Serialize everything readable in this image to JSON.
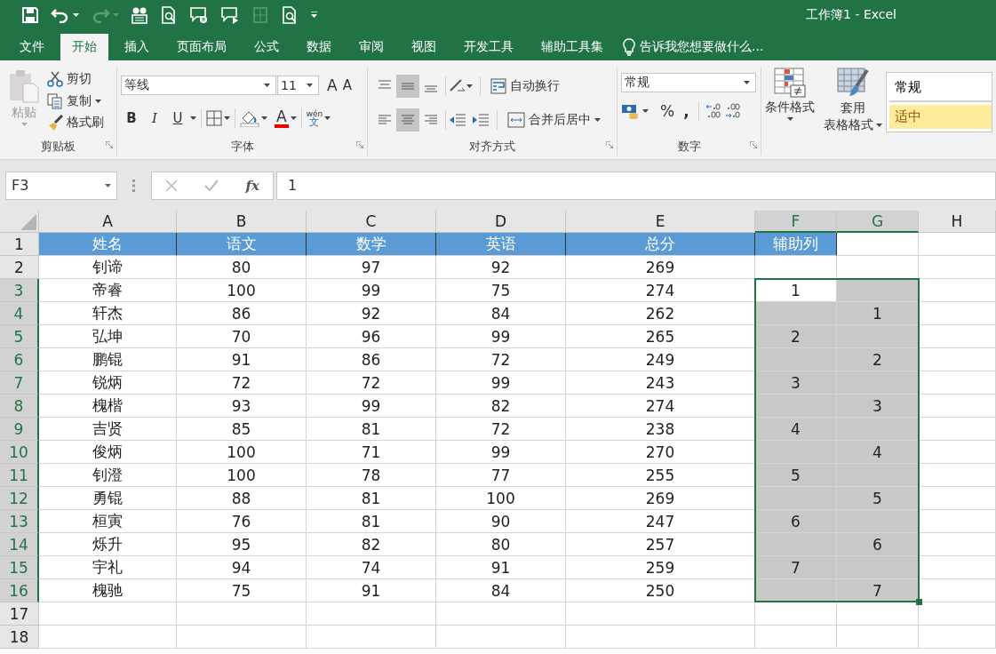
{
  "window": {
    "title": "工作簿1 - Excel"
  },
  "ribbon_tabs": [
    {
      "label": "文件",
      "selected": false
    },
    {
      "label": "开始",
      "selected": true
    },
    {
      "label": "插入",
      "selected": false
    },
    {
      "label": "页面布局",
      "selected": false
    },
    {
      "label": "公式",
      "selected": false
    },
    {
      "label": "数据",
      "selected": false
    },
    {
      "label": "审阅",
      "selected": false
    },
    {
      "label": "视图",
      "selected": false
    },
    {
      "label": "开发工具",
      "selected": false
    },
    {
      "label": "辅助工具集",
      "selected": false
    }
  ],
  "tell_me": "告诉我您想要做什么...",
  "clipboard": {
    "paste": "粘贴",
    "cut": "剪切",
    "copy": "复制",
    "format_painter": "格式刷",
    "label": "剪贴板"
  },
  "font": {
    "name": "等线",
    "size": "11",
    "grow": "A",
    "shrink": "A",
    "bold": "B",
    "italic": "I",
    "underline": "U",
    "color_button": "A",
    "phonetic_top": "wén",
    "phonetic_bottom": "文",
    "label": "字体"
  },
  "alignment": {
    "vertical": [
      {
        "selected": false
      },
      {
        "selected": true
      },
      {
        "selected": false
      }
    ],
    "horizontal": [
      {
        "selected": false
      },
      {
        "selected": true
      },
      {
        "selected": false
      }
    ],
    "wrap_text": "自动换行",
    "merge": "合并后居中",
    "label": "对齐方式"
  },
  "number": {
    "format": "常规",
    "percent": "%",
    "comma": ",",
    "label": "数字"
  },
  "styles": {
    "conditional_format": "条件格式",
    "table_format_line1": "套用",
    "table_format_line2": "表格格式",
    "cell_styles": [
      {
        "label": "常规",
        "kind": "normal"
      },
      {
        "label": "适中",
        "kind": "neutral"
      }
    ]
  },
  "formula_bar": {
    "name_box": "F3",
    "function_label": "fx",
    "value": "1"
  },
  "sheet": {
    "columns": [
      {
        "label": "A",
        "selected": false
      },
      {
        "label": "B",
        "selected": false
      },
      {
        "label": "C",
        "selected": false
      },
      {
        "label": "D",
        "selected": false
      },
      {
        "label": "E",
        "selected": false
      },
      {
        "label": "F",
        "selected": true
      },
      {
        "label": "G",
        "selected": true
      },
      {
        "label": "H",
        "selected": false
      }
    ],
    "rows": [
      {
        "number": "1",
        "selected": false,
        "kind": "header",
        "cells": [
          "姓名",
          "语文",
          "数学",
          "英语",
          "总分"
        ],
        "aux": [
          {
            "text": "辅助列",
            "header": true,
            "selected": false
          },
          {
            "header": false,
            "selected": false
          }
        ]
      },
      {
        "number": "2",
        "selected": false,
        "kind": "data",
        "cells": [
          "钊谛",
          "80",
          "97",
          "92",
          "269"
        ],
        "aux": [
          {
            "header": false,
            "selected": false
          },
          {
            "header": false,
            "selected": false
          }
        ]
      },
      {
        "number": "3",
        "selected": true,
        "kind": "data",
        "cells": [
          "帝睿",
          "100",
          "99",
          "75",
          "274"
        ],
        "aux": [
          {
            "text": "1",
            "header": false,
            "selected": true
          },
          {
            "header": false,
            "selected": true
          }
        ]
      },
      {
        "number": "4",
        "selected": true,
        "kind": "data",
        "cells": [
          "轩杰",
          "86",
          "92",
          "84",
          "262"
        ],
        "aux": [
          {
            "header": false,
            "selected": true
          },
          {
            "text": "1",
            "header": false,
            "selected": true
          }
        ]
      },
      {
        "number": "5",
        "selected": true,
        "kind": "data",
        "cells": [
          "弘坤",
          "70",
          "96",
          "99",
          "265"
        ],
        "aux": [
          {
            "text": "2",
            "header": false,
            "selected": true
          },
          {
            "header": false,
            "selected": true
          }
        ]
      },
      {
        "number": "6",
        "selected": true,
        "kind": "data",
        "cells": [
          "鹏锟",
          "91",
          "86",
          "72",
          "249"
        ],
        "aux": [
          {
            "header": false,
            "selected": true
          },
          {
            "text": "2",
            "header": false,
            "selected": true
          }
        ]
      },
      {
        "number": "7",
        "selected": true,
        "kind": "data",
        "cells": [
          "锐炳",
          "72",
          "72",
          "99",
          "243"
        ],
        "aux": [
          {
            "text": "3",
            "header": false,
            "selected": true
          },
          {
            "header": false,
            "selected": true
          }
        ]
      },
      {
        "number": "8",
        "selected": true,
        "kind": "data",
        "cells": [
          "槐楷",
          "93",
          "99",
          "82",
          "274"
        ],
        "aux": [
          {
            "header": false,
            "selected": true
          },
          {
            "text": "3",
            "header": false,
            "selected": true
          }
        ]
      },
      {
        "number": "9",
        "selected": true,
        "kind": "data",
        "cells": [
          "吉贤",
          "85",
          "81",
          "72",
          "238"
        ],
        "aux": [
          {
            "text": "4",
            "header": false,
            "selected": true
          },
          {
            "header": false,
            "selected": true
          }
        ]
      },
      {
        "number": "10",
        "selected": true,
        "kind": "data",
        "cells": [
          "俊炳",
          "100",
          "71",
          "99",
          "270"
        ],
        "aux": [
          {
            "header": false,
            "selected": true
          },
          {
            "text": "4",
            "header": false,
            "selected": true
          }
        ]
      },
      {
        "number": "11",
        "selected": true,
        "kind": "data",
        "cells": [
          "钊澄",
          "100",
          "78",
          "77",
          "255"
        ],
        "aux": [
          {
            "text": "5",
            "header": false,
            "selected": true
          },
          {
            "header": false,
            "selected": true
          }
        ]
      },
      {
        "number": "12",
        "selected": true,
        "kind": "data",
        "cells": [
          "勇锟",
          "88",
          "81",
          "100",
          "269"
        ],
        "aux": [
          {
            "header": false,
            "selected": true
          },
          {
            "text": "5",
            "header": false,
            "selected": true
          }
        ]
      },
      {
        "number": "13",
        "selected": true,
        "kind": "data",
        "cells": [
          "桓寅",
          "76",
          "81",
          "90",
          "247"
        ],
        "aux": [
          {
            "text": "6",
            "header": false,
            "selected": true
          },
          {
            "header": false,
            "selected": true
          }
        ]
      },
      {
        "number": "14",
        "selected": true,
        "kind": "data",
        "cells": [
          "烁升",
          "95",
          "82",
          "80",
          "257"
        ],
        "aux": [
          {
            "header": false,
            "selected": true
          },
          {
            "text": "6",
            "header": false,
            "selected": true
          }
        ]
      },
      {
        "number": "15",
        "selected": true,
        "kind": "data",
        "cells": [
          "宇礼",
          "94",
          "74",
          "91",
          "259"
        ],
        "aux": [
          {
            "text": "7",
            "header": false,
            "selected": true
          },
          {
            "header": false,
            "selected": true
          }
        ]
      },
      {
        "number": "16",
        "selected": true,
        "kind": "data",
        "cells": [
          "槐驰",
          "75",
          "91",
          "84",
          "250"
        ],
        "aux": [
          {
            "header": false,
            "selected": true
          },
          {
            "text": "7",
            "header": false,
            "selected": true
          }
        ]
      },
      {
        "number": "17",
        "selected": false,
        "kind": "empty"
      },
      {
        "number": "18",
        "selected": false,
        "kind": "empty"
      }
    ]
  }
}
